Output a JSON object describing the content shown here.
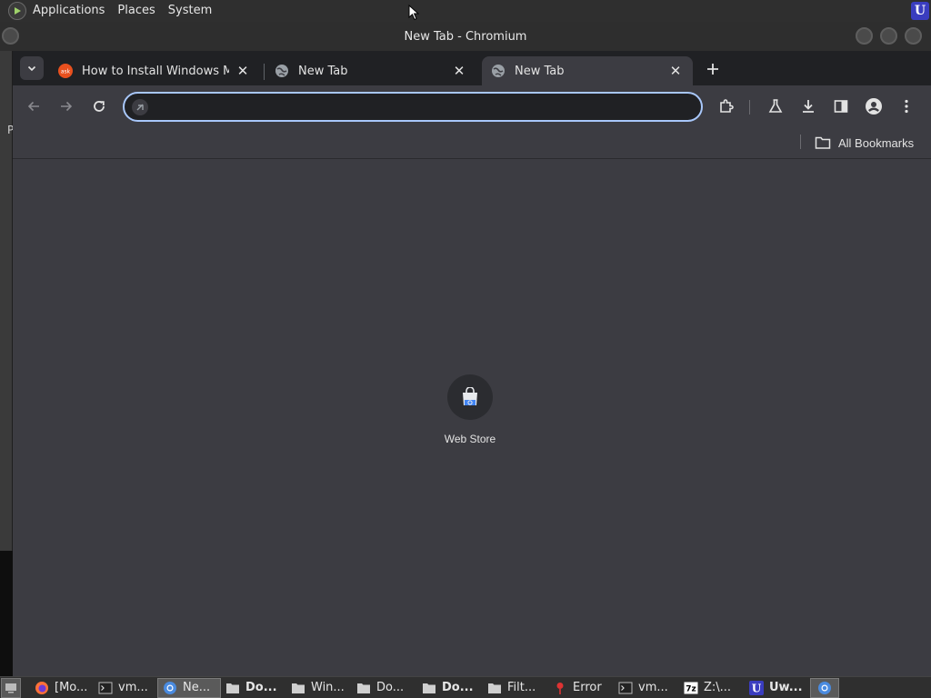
{
  "top_panel": {
    "menus": [
      "Applications",
      "Places",
      "System"
    ]
  },
  "background_window": {
    "partial_text": "P"
  },
  "window": {
    "title": "New Tab - Chromium"
  },
  "tabs": [
    {
      "title": "How to Install Windows Media",
      "favicon": "ask-icon",
      "active": false
    },
    {
      "title": "New Tab",
      "favicon": "globe-icon",
      "active": false
    },
    {
      "title": "New Tab",
      "favicon": "globe-icon",
      "active": true
    }
  ],
  "omnibox": {
    "value": "",
    "placeholder": ""
  },
  "bookmarks": {
    "all_bookmarks_label": "All Bookmarks"
  },
  "shortcuts": [
    {
      "label": "Web Store",
      "icon": "web-store-icon"
    }
  ],
  "taskbar": {
    "tasks": [
      {
        "label": "[Mo...",
        "icon": "firefox-icon",
        "bold": false,
        "active": false
      },
      {
        "label": "vm...",
        "icon": "terminal-icon",
        "bold": false,
        "active": false
      },
      {
        "label": "Ne...",
        "icon": "chromium-icon",
        "bold": false,
        "active": true
      },
      {
        "label": "Do...",
        "icon": "folder-icon",
        "bold": true,
        "active": false
      },
      {
        "label": "Win...",
        "icon": "folder-icon",
        "bold": false,
        "active": false
      },
      {
        "label": "Do...",
        "icon": "folder-icon",
        "bold": false,
        "active": false
      },
      {
        "label": "Do...",
        "icon": "folder-icon",
        "bold": true,
        "active": false
      },
      {
        "label": "Filt...",
        "icon": "folder-icon",
        "bold": false,
        "active": false
      },
      {
        "label": "Error",
        "icon": "error-icon",
        "bold": false,
        "active": false
      },
      {
        "label": "vm...",
        "icon": "terminal-icon",
        "bold": false,
        "active": false
      },
      {
        "label": "Z:\\...",
        "icon": "7zip-icon",
        "bold": false,
        "active": false
      },
      {
        "label": "Uw...",
        "icon": "uwp-icon",
        "bold": true,
        "active": false
      },
      {
        "label": "",
        "icon": "chromium-icon",
        "bold": false,
        "active": true
      }
    ]
  },
  "colors": {
    "accent": "#a8c7fa",
    "tabstrip": "#202124",
    "toolbar": "#3c3c42",
    "panel": "#2f2f2f"
  }
}
